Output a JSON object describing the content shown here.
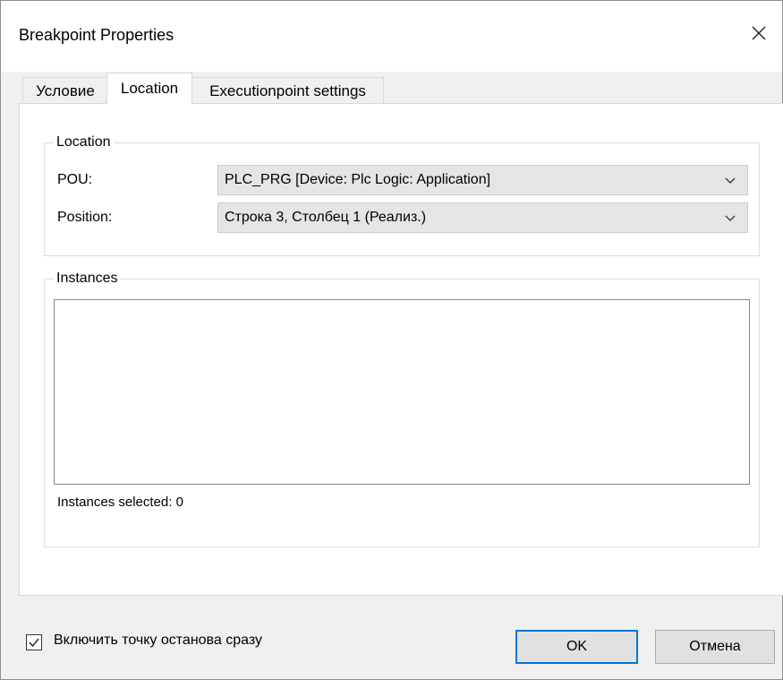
{
  "window": {
    "title": "Breakpoint Properties"
  },
  "tabs": [
    {
      "label": "Условие",
      "active": false
    },
    {
      "label": "Location",
      "active": true
    },
    {
      "label": "Executionpoint settings",
      "active": false
    }
  ],
  "location_group": {
    "legend": "Location",
    "pou": {
      "label": "POU:",
      "value": "PLC_PRG [Device: Plc Logic: Application]"
    },
    "position": {
      "label": "Position:",
      "value": "Строка 3, Столбец 1 (Реализ.)"
    }
  },
  "instances_group": {
    "legend": "Instances",
    "status": "Instances selected: 0"
  },
  "footer": {
    "checkbox_label": "Включить точку останова сразу",
    "checkbox_checked": true,
    "ok_label": "OK",
    "cancel_label": "Отмена"
  },
  "colors": {
    "accent": "#0078d7"
  }
}
